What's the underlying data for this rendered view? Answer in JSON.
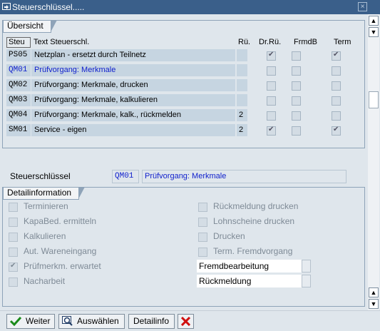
{
  "window": {
    "title": "Steuerschlüssel....."
  },
  "overview": {
    "title": "Übersicht",
    "headers": {
      "key": "Steu",
      "text": "Text Steuerschl.",
      "ru": "Rü.",
      "drru": "Dr.Rü.",
      "frmdb": "FrmdB",
      "term": "Term"
    },
    "rows": [
      {
        "key": "PS05",
        "text": "Netzplan - ersetzt durch Teilnetz",
        "ru": "",
        "drru": true,
        "frmdb": false,
        "term": true,
        "selected": false
      },
      {
        "key": "QM01",
        "text": "Prüfvorgang: Merkmale",
        "ru": "",
        "drru": false,
        "frmdb": false,
        "term": false,
        "selected": true
      },
      {
        "key": "QM02",
        "text": "Prüfvorgang: Merkmale, drucken",
        "ru": "",
        "drru": false,
        "frmdb": false,
        "term": false,
        "selected": false
      },
      {
        "key": "QM03",
        "text": "Prüfvorgang: Merkmale, kalkulieren",
        "ru": "",
        "drru": false,
        "frmdb": false,
        "term": false,
        "selected": false
      },
      {
        "key": "QM04",
        "text": "Prüfvorgang: Merkmale, kalk., rückmelden",
        "ru": "2",
        "drru": false,
        "frmdb": false,
        "term": false,
        "selected": false
      },
      {
        "key": "SM01",
        "text": "Service - eigen",
        "ru": "2",
        "drru": true,
        "frmdb": false,
        "term": true,
        "selected": false
      }
    ]
  },
  "selection": {
    "label": "Steuerschlüssel",
    "key": "QM01",
    "text": "Prüfvorgang: Merkmale"
  },
  "detail": {
    "title": "Detailinformation",
    "left": [
      {
        "label": "Terminieren",
        "checked": false
      },
      {
        "label": "KapaBed. ermitteln",
        "checked": false
      },
      {
        "label": "Kalkulieren",
        "checked": false
      },
      {
        "label": "Aut. Wareneingang",
        "checked": false
      },
      {
        "label": "Prüfmerkm. erwartet",
        "checked": true
      },
      {
        "label": "Nacharbeit",
        "checked": false
      }
    ],
    "right": [
      {
        "label": "Rückmeldung drucken",
        "checked": false
      },
      {
        "label": "Lohnscheine drucken",
        "checked": false
      },
      {
        "label": "Drucken",
        "checked": false
      },
      {
        "label": "Term. Fremdvorgang",
        "checked": false
      }
    ],
    "fields": {
      "fremdbearbeitung": "Fremdbearbeitung",
      "rueckmeldung": "Rückmeldung"
    }
  },
  "buttons": {
    "weiter": "Weiter",
    "auswaehlen": "Auswählen",
    "detailinfo": "Detailinfo"
  },
  "colors": {
    "titlebar": "#3a5f8a",
    "panel": "#dfe6ec",
    "cell": "#c6d5e1",
    "selected_text": "#0e1ecc"
  }
}
